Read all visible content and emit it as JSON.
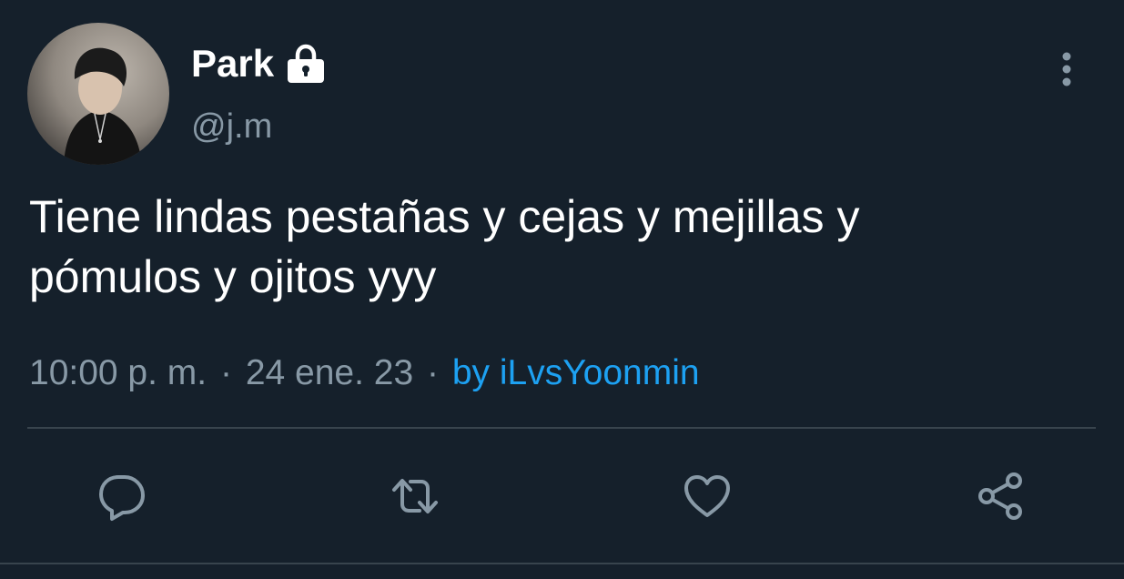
{
  "colors": {
    "background": "#15202b",
    "text_primary": "#ffffff",
    "text_secondary": "#8899a6",
    "link": "#1da1f2",
    "divider": "#38444d"
  },
  "author": {
    "display_name": "Park",
    "handle": "@j.m",
    "locked_icon": "lock-icon",
    "avatar_icon": "avatar-photo"
  },
  "tweet": {
    "text_line_1": "Tiene lindas pestañas y cejas y mejillas y",
    "text_line_2": "pómulos y ojitos yyy",
    "time": "10:00 p. m.",
    "separator": "·",
    "date": "24 ene. 23",
    "source": "by iLvsYoonmin"
  },
  "actions": [
    {
      "name": "reply",
      "icon": "comment-icon"
    },
    {
      "name": "retweet",
      "icon": "retweet-icon"
    },
    {
      "name": "like",
      "icon": "heart-icon"
    },
    {
      "name": "share",
      "icon": "share-icon"
    }
  ],
  "menu_icon": "more-vertical-icon"
}
